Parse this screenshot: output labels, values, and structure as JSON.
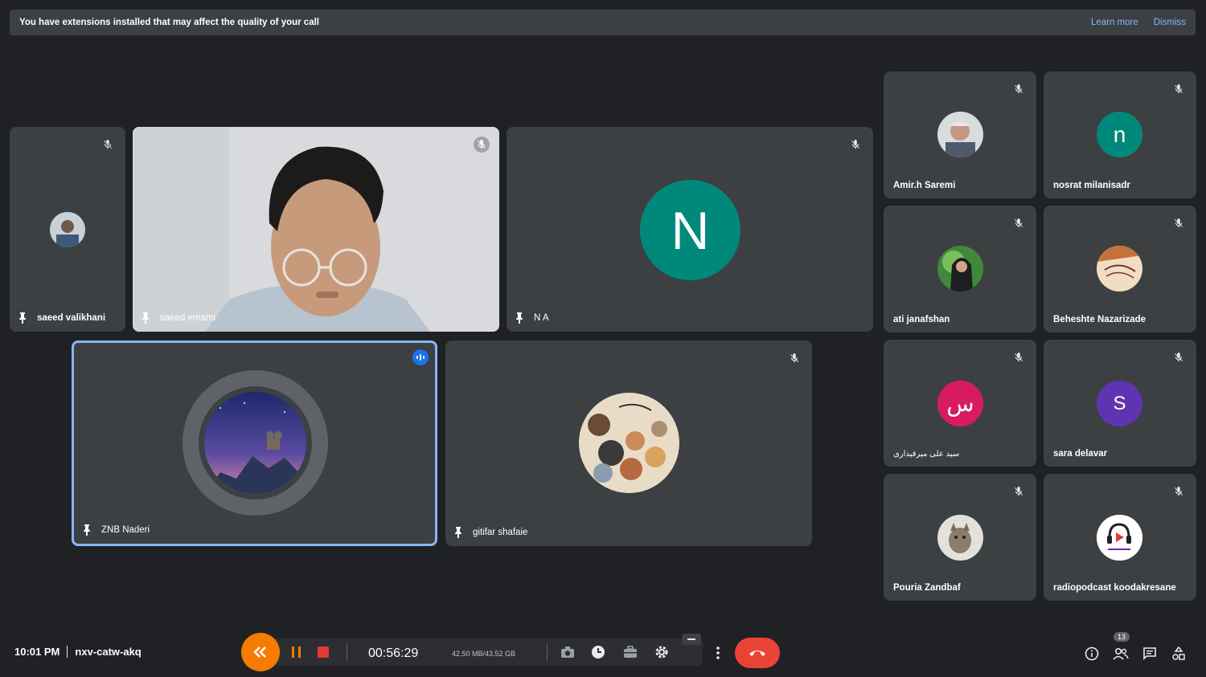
{
  "banner": {
    "message": "You have extensions installed that may affect the quality of your call",
    "learn_more": "Learn more",
    "dismiss": "Dismiss"
  },
  "tiles": {
    "saeed_valikhani": {
      "name": "saeed valikhani"
    },
    "saeed_emami": {
      "name": "saeed emami"
    },
    "na": {
      "name": "N A",
      "initial": "N",
      "color": "#00897b"
    },
    "znb": {
      "name": "ZNB Naderi"
    },
    "gitifar": {
      "name": "gitifar shafaie"
    },
    "amir": {
      "name": "Amir.h Saremi"
    },
    "nosrat": {
      "name": "nosrat milanisadr",
      "initial": "n",
      "color": "#00897b"
    },
    "ati": {
      "name": "ati janafshan"
    },
    "beheshte": {
      "name": "Beheshte Nazarizade"
    },
    "seyed": {
      "name": "سید علی میرقیداری",
      "initial": "س",
      "color": "#d81b60"
    },
    "sara": {
      "name": "sara delavar",
      "initial": "S",
      "color": "#5e35b1"
    },
    "pouria": {
      "name": "Pouria Zandbaf"
    },
    "radio": {
      "name": "radiopodcast koodakresane"
    }
  },
  "footer": {
    "time": "10:01 PM",
    "meeting_code": "nxv-catw-akq",
    "participants_count": "13"
  },
  "recorder": {
    "timer": "00:56:29",
    "size": "42.50 MB/43.52 GB"
  }
}
